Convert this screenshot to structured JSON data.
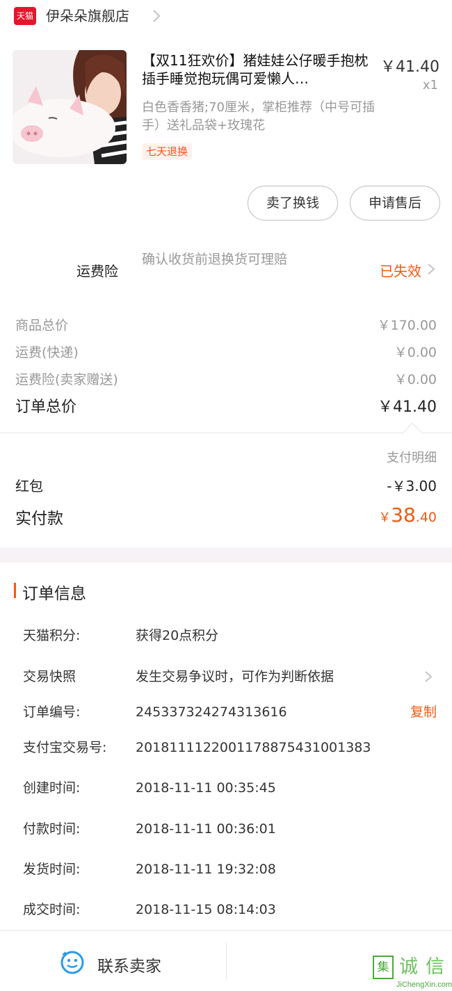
{
  "store": {
    "logo_text": "天猫",
    "name": "伊朵朵旗舰店",
    "icons": {
      "logo": "tmall-cat-logo",
      "chevron": "chevron-right-icon"
    }
  },
  "product": {
    "title": "【双11狂欢价】猪娃娃公仔暖手抱枕插手睡觉抱玩偶可爱懒人…",
    "price": "￥41.40",
    "quantity": "x1",
    "sku": "白色香香猪;70厘米，掌柜推荐（中号可插手）送礼品袋+玫瑰花",
    "tag": "七天退换",
    "image_icon": "product-photo-pig-plush"
  },
  "actions": {
    "sell_label": "卖了换钱",
    "aftersale_label": "申请售后"
  },
  "insurance": {
    "label": "运费险",
    "description": "确认收货前退换货可理赔",
    "status": "已失效"
  },
  "summary": {
    "rows": [
      {
        "label": "商品总价",
        "value": "￥170.00"
      },
      {
        "label": "运费(快递)",
        "value": "￥0.00"
      },
      {
        "label": "运费险(卖家赠送)",
        "value": "￥0.00"
      }
    ],
    "total_label": "订单总价",
    "total_value": "￥41.40"
  },
  "payment": {
    "detail_label": "支付明细",
    "redpack_label": "红包",
    "redpack_value": "-￥3.00",
    "actual_label": "实付款",
    "actual_yen": "￥",
    "actual_int": "38",
    "actual_dec": ".40"
  },
  "order_info": {
    "title": "订单信息",
    "rows": [
      {
        "key": "天猫积分:",
        "value": "获得20点积分"
      },
      {
        "key": "交易快照",
        "value": "发生交易争议时，可作为判断依据"
      },
      {
        "key": "订单编号:",
        "value": "245337324274313616"
      },
      {
        "key": "支付宝交易号:",
        "value": "2018111122001178875431001383"
      },
      {
        "key": "创建时间:",
        "value": "2018-11-11 00:35:45"
      },
      {
        "key": "付款时间:",
        "value": "2018-11-11 00:36:01"
      },
      {
        "key": "发货时间:",
        "value": "2018-11-11 19:32:08"
      },
      {
        "key": "成交时间:",
        "value": "2018-11-15 08:14:03"
      }
    ],
    "copy_label": "复制"
  },
  "bottom": {
    "contact_label": "联系卖家",
    "contact_icon": "chat-bubble-icon"
  },
  "watermark": {
    "box_char": "集",
    "char1": "诚",
    "char2": "信",
    "url": "JiChengXin.com"
  },
  "colors": {
    "accent": "#f05a14",
    "tmall_red": "#e3162d",
    "muted": "#999999",
    "text": "#333333"
  }
}
